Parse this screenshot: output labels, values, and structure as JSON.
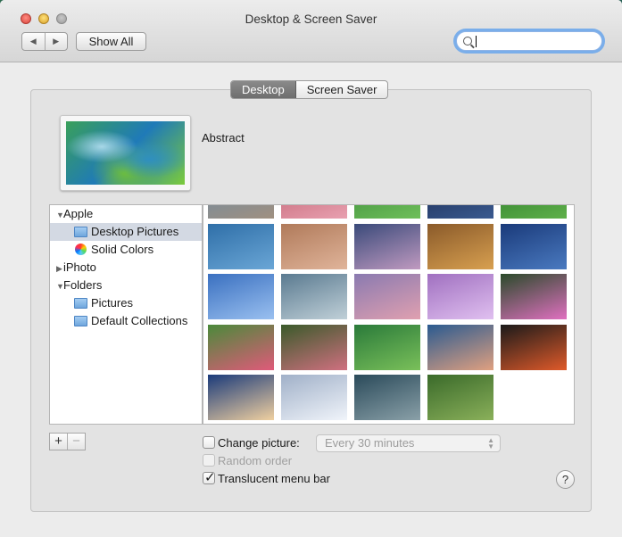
{
  "window": {
    "title": "Desktop & Screen Saver",
    "nav_back": "◀",
    "nav_forward": "▶",
    "show_all_label": "Show All",
    "search_value": ""
  },
  "tabs": [
    {
      "label": "Desktop",
      "active": true
    },
    {
      "label": "Screen Saver",
      "active": false
    }
  ],
  "current_picture": {
    "name": "Abstract"
  },
  "sidebar": {
    "items": [
      {
        "label": "Apple",
        "expanded": true,
        "icon": "disclosure-open"
      },
      {
        "label": "Desktop Pictures",
        "selected": true,
        "icon": "folder-icon"
      },
      {
        "label": "Solid Colors",
        "icon": "color-wheel-icon"
      },
      {
        "label": "iPhoto",
        "expanded": false,
        "icon": "disclosure-closed"
      },
      {
        "label": "Folders",
        "expanded": true,
        "icon": "disclosure-open"
      },
      {
        "label": "Pictures",
        "icon": "folder-icon"
      },
      {
        "label": "Default Collections",
        "icon": "folder-icon"
      }
    ]
  },
  "thumbnails": [
    {
      "name": "abstract-blue-partial",
      "colors": [
        "#6b8aa3",
        "#a09080"
      ]
    },
    {
      "name": "pink-flower-partial",
      "colors": [
        "#c06070",
        "#e8a0b0"
      ]
    },
    {
      "name": "green-grass-partial",
      "colors": [
        "#3a8a3a",
        "#6fbf5a"
      ]
    },
    {
      "name": "blue-night-partial",
      "colors": [
        "#1a2a50",
        "#3a5a90"
      ]
    },
    {
      "name": "green-field-partial",
      "colors": [
        "#2a7a2a",
        "#5fb04a"
      ]
    },
    {
      "name": "water-droplets",
      "colors": [
        "#2f6fa8",
        "#6aa6d6"
      ]
    },
    {
      "name": "tree-island",
      "colors": [
        "#b07a5a",
        "#e0b49a"
      ]
    },
    {
      "name": "mountain-lake",
      "colors": [
        "#3a4a7a",
        "#c09ac0"
      ]
    },
    {
      "name": "lion",
      "colors": [
        "#8a5a2a",
        "#d8a050"
      ]
    },
    {
      "name": "galaxy",
      "colors": [
        "#1a3a7a",
        "#4a7ac0"
      ]
    },
    {
      "name": "moon-sky",
      "colors": [
        "#3a70c0",
        "#9ac0f0"
      ]
    },
    {
      "name": "misty-hills",
      "colors": [
        "#5a7a90",
        "#c0d0d8"
      ]
    },
    {
      "name": "mount-fuji",
      "colors": [
        "#8a7ab0",
        "#e0a0b0"
      ]
    },
    {
      "name": "purple-haze",
      "colors": [
        "#a070c0",
        "#e0c0f0"
      ]
    },
    {
      "name": "lotus",
      "colors": [
        "#2a4a2a",
        "#e070c0"
      ]
    },
    {
      "name": "pink-poppies",
      "colors": [
        "#4a8a3a",
        "#e05a7a"
      ]
    },
    {
      "name": "berries",
      "colors": [
        "#3a5a2a",
        "#d07080"
      ]
    },
    {
      "name": "rice-terraces",
      "colors": [
        "#2a7a3a",
        "#7ac05a"
      ]
    },
    {
      "name": "ocean-wave",
      "colors": [
        "#2a5a90",
        "#e0a080"
      ]
    },
    {
      "name": "color-prism",
      "colors": [
        "#1a1a1a",
        "#e05a2a"
      ]
    },
    {
      "name": "earth-horizon",
      "colors": [
        "#1a3a7a",
        "#f0d0a0"
      ]
    },
    {
      "name": "snow-drifts",
      "colors": [
        "#a0b0c8",
        "#f0f4fa"
      ]
    },
    {
      "name": "storm-clouds",
      "colors": [
        "#2a4a5a",
        "#8aa0a8"
      ]
    },
    {
      "name": "zebras",
      "colors": [
        "#3a6a2a",
        "#8ab05a"
      ]
    }
  ],
  "controls": {
    "add_button": "+",
    "remove_button": "−",
    "change_picture_label": "Change picture:",
    "change_picture_checked": false,
    "interval_value": "Every 30 minutes",
    "random_order_label": "Random order",
    "random_order_checked": false,
    "translucent_menu_label": "Translucent menu bar",
    "translucent_menu_checked": true,
    "help_button": "?"
  }
}
